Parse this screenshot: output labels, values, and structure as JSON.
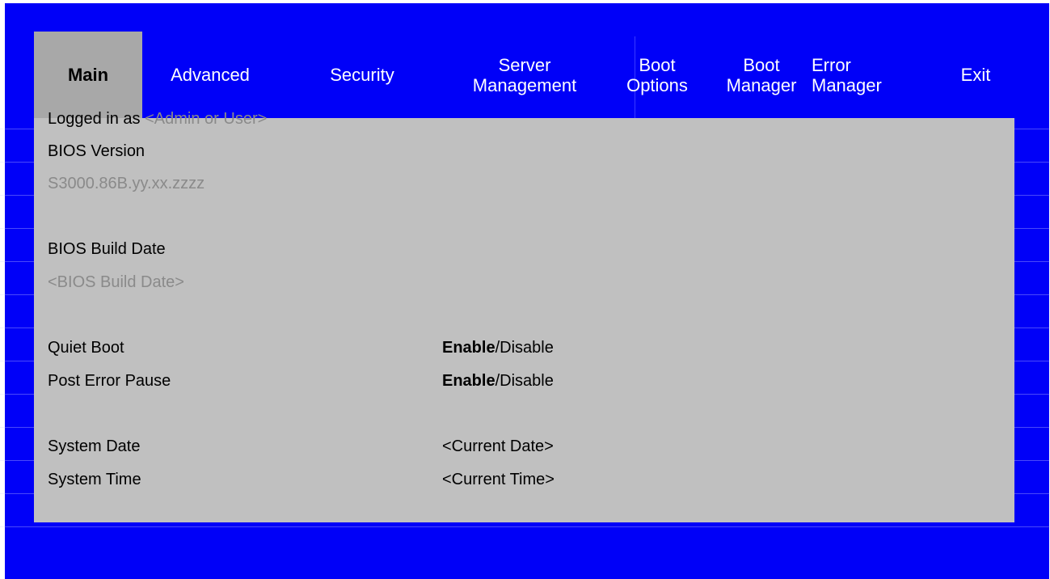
{
  "colors": {
    "background": "#0000f8",
    "panel": "#c0c0c0",
    "active_tab": "#a8a8a8",
    "dim_text": "#8a8a8a"
  },
  "tabs": [
    {
      "label": "Main",
      "active": true
    },
    {
      "label": "Advanced"
    },
    {
      "label": "Security"
    },
    {
      "label": "Server\nManagement"
    },
    {
      "label": "Boot\nOptions"
    },
    {
      "label": "Boot\nManager"
    },
    {
      "label": "Error\nManager"
    },
    {
      "label": "Exit"
    }
  ],
  "main": {
    "logged_in_label": "Logged in as",
    "logged_in_value": "<Admin or User>",
    "bios_version_label": "BIOS Version",
    "bios_version_value": "S3000.86B.yy.xx.zzzz",
    "bios_build_date_label": "BIOS Build Date",
    "bios_build_date_value": "<BIOS Build Date>",
    "quiet_boot": {
      "label": "Quiet Boot",
      "selected": "Enable",
      "rest": "/Disable"
    },
    "post_error_pause": {
      "label": "Post Error Pause",
      "selected": "Enable",
      "rest": "/Disable"
    },
    "system_date": {
      "label": "System Date",
      "value": "<Current Date>"
    },
    "system_time": {
      "label": "System Time",
      "value": "<Current Time>"
    }
  }
}
